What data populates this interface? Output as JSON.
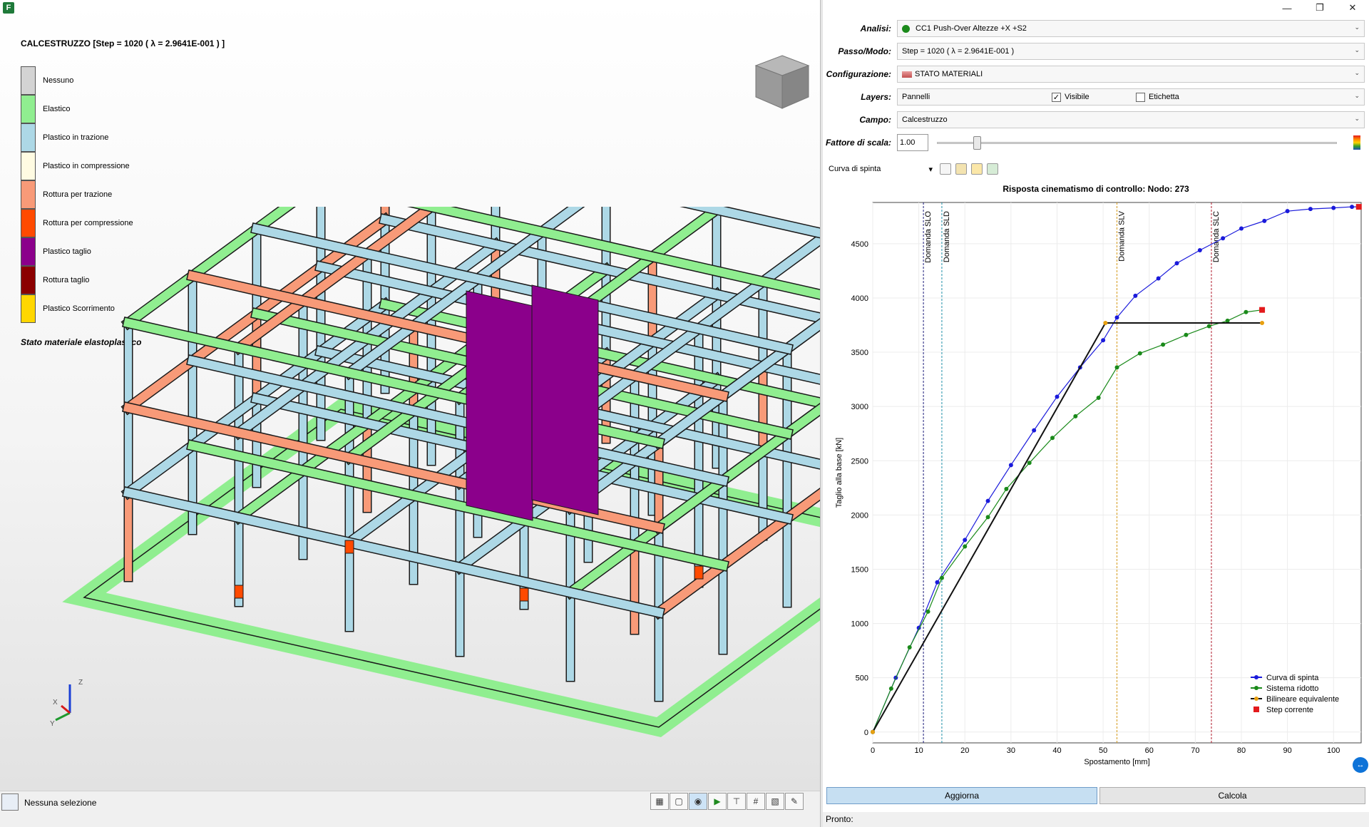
{
  "viewport": {
    "title": "CALCESTRUZZO [Step = 1020 ( λ = 2.9641E-001 ) ]",
    "legend": [
      {
        "label": "Nessuno",
        "color": "#d3d3d3"
      },
      {
        "label": "Elastico",
        "color": "#90ee90"
      },
      {
        "label": "Plastico in trazione",
        "color": "#add8e6"
      },
      {
        "label": "Plastico in compressione",
        "color": "#fffbe2"
      },
      {
        "label": "Rottura per trazione",
        "color": "#f89a78"
      },
      {
        "label": "Rottura per compressione",
        "color": "#ff4a00"
      },
      {
        "label": "Plastico taglio",
        "color": "#8b008b"
      },
      {
        "label": "Rottura taglio",
        "color": "#8b0000"
      },
      {
        "label": "Plastico Scorrimento",
        "color": "#ffd700"
      }
    ],
    "legend_subtitle": "Stato materiale elastoplastico",
    "axes": {
      "x": "X",
      "y": "Y",
      "z": "Z"
    }
  },
  "window": {
    "minimize": "—",
    "restore": "❐",
    "close": "✕"
  },
  "panel": {
    "analisi": {
      "label": "Analisi:",
      "value": "CC1 Push-Over Altezze +X +S2"
    },
    "passo": {
      "label": "Passo/Modo:",
      "value": "Step = 1020 ( λ = 2.9641E-001 )"
    },
    "configurazione": {
      "label": "Configurazione:",
      "value": "STATO MATERIALI"
    },
    "layers": {
      "label": "Layers:",
      "value": "Pannelli",
      "visible_label": "Visibile",
      "visible_checked": true,
      "label_option": "Etichetta",
      "label_checked": false
    },
    "campo": {
      "label": "Campo:",
      "value": "Calcestruzzo"
    },
    "scala": {
      "label": "Fattore di scala:",
      "value": "1.00",
      "slider_fraction": 0.09
    },
    "curve_select": "Curva di spinta"
  },
  "chart_data": {
    "type": "line",
    "title": "Risposta cinematismo di controllo: Nodo: 273",
    "xlabel": "Spostamento [mm]",
    "ylabel": "Taglio alla base [kN]",
    "xlim": [
      0,
      106
    ],
    "ylim": [
      -100,
      4880
    ],
    "x_ticks": [
      0,
      10,
      20,
      30,
      40,
      50,
      60,
      70,
      80,
      90,
      100
    ],
    "y_ticks": [
      0,
      500,
      1000,
      1500,
      2000,
      2500,
      3000,
      3500,
      4000,
      4500
    ],
    "grid": true,
    "legend_position": "bottom-right",
    "series": [
      {
        "name": "Curva di spinta",
        "color": "#1a1adb",
        "x": [
          0,
          5,
          10,
          14,
          20,
          25,
          30,
          35,
          40,
          45,
          50,
          53,
          57,
          62,
          66,
          71,
          76,
          80,
          85,
          90,
          95,
          100,
          104,
          105.5
        ],
        "y": [
          0,
          500,
          960,
          1380,
          1770,
          2130,
          2460,
          2780,
          3090,
          3360,
          3610,
          3820,
          4020,
          4180,
          4320,
          4440,
          4550,
          4640,
          4710,
          4800,
          4820,
          4830,
          4840,
          4840
        ]
      },
      {
        "name": "Sistema ridotto",
        "color": "#1a8a1a",
        "x": [
          0,
          4,
          8,
          12,
          15,
          20,
          25,
          29,
          34,
          39,
          44,
          49,
          53,
          58,
          63,
          68,
          73,
          77,
          81,
          84.5
        ],
        "y": [
          0,
          400,
          780,
          1110,
          1420,
          1710,
          1980,
          2240,
          2480,
          2710,
          2910,
          3080,
          3360,
          3490,
          3570,
          3660,
          3740,
          3790,
          3870,
          3890
        ]
      },
      {
        "name": "Bilineare equivalente",
        "color": "#111111",
        "x": [
          0,
          50.5,
          84.5
        ],
        "y": [
          0,
          3770,
          3770
        ]
      },
      {
        "name": "Step corrente",
        "color": "#e31a1c",
        "x": [
          105.5,
          84.5
        ],
        "y": [
          4840,
          3890
        ]
      }
    ],
    "vlines": [
      {
        "label": "Domanda SLO",
        "x": 11,
        "color": "#1a1a7a"
      },
      {
        "label": "Domanda SLD",
        "x": 15,
        "color": "#1e90a8"
      },
      {
        "label": "Domanda SLV",
        "x": 53,
        "color": "#d49a1a"
      },
      {
        "label": "Domanda SLC",
        "x": 73.5,
        "color": "#b01a2a"
      }
    ]
  },
  "buttons": {
    "aggiorna": "Aggiorna",
    "calcola": "Calcola"
  },
  "status": {
    "right": "Pronto:",
    "left": "Nessuna selezione"
  }
}
